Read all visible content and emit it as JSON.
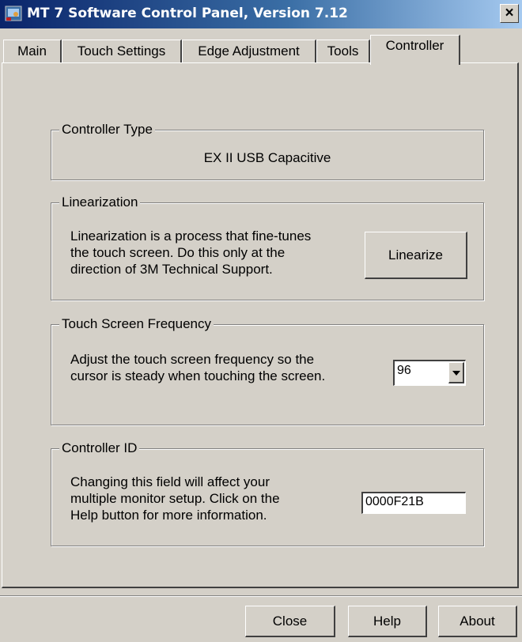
{
  "window": {
    "title": "MT 7 Software Control Panel, Version 7.12",
    "close_glyph": "×"
  },
  "tabs": [
    {
      "label": "Main"
    },
    {
      "label": "Touch Settings"
    },
    {
      "label": "Edge Adjustment"
    },
    {
      "label": "Tools"
    },
    {
      "label": "Controller",
      "active": true
    }
  ],
  "controller_type": {
    "legend": "Controller Type",
    "value": "EX II USB Capacitive"
  },
  "linearization": {
    "legend": "Linearization",
    "description_lines": [
      "Linearization is a process that fine-tunes",
      "the touch screen. Do this only at the",
      "direction of 3M Technical Support."
    ],
    "button_label": "Linearize"
  },
  "frequency": {
    "legend": "Touch Screen Frequency",
    "description_lines": [
      "Adjust the touch screen frequency so the",
      "cursor is steady when touching the screen."
    ],
    "selected_value": "96"
  },
  "controller_id": {
    "legend": "Controller ID",
    "description_lines": [
      "Changing this field will affect your",
      "multiple monitor setup. Click on the",
      "Help button for more information."
    ],
    "value": "0000F21B"
  },
  "footer": {
    "close_label": "Close",
    "help_label": "Help",
    "about_label": "About"
  },
  "icons": {
    "app_icon": "app-icon",
    "close_icon": "close-icon",
    "dropdown_icon": "chevron-down-icon"
  },
  "colors": {
    "titlebar_start": "#0a246a",
    "titlebar_end": "#a6caf0",
    "face": "#d4d0c8"
  }
}
